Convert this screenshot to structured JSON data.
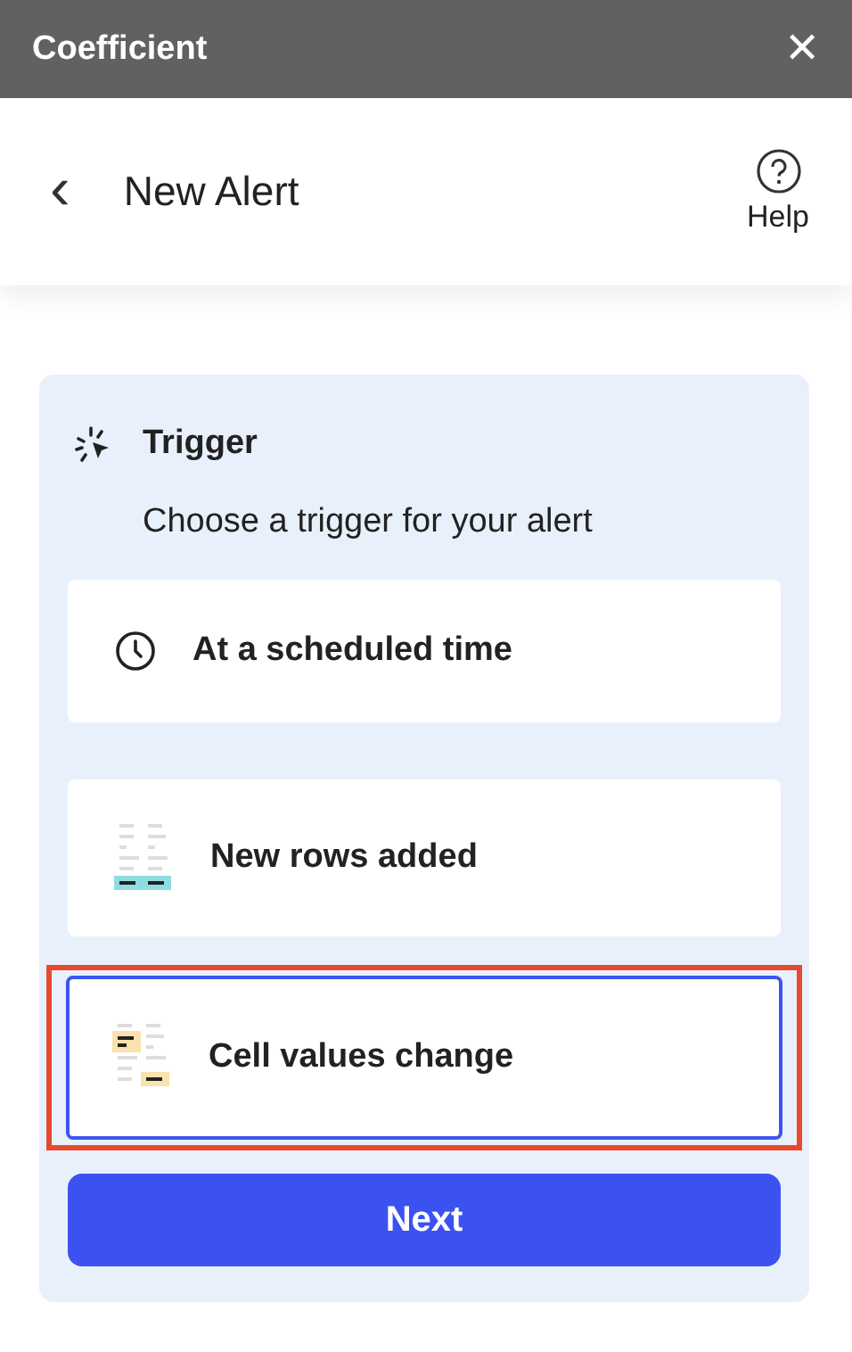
{
  "window": {
    "title": "Coefficient",
    "close": "✕"
  },
  "header": {
    "back": "‹",
    "title": "New Alert",
    "help": "Help"
  },
  "trigger": {
    "title": "Trigger",
    "subtitle": "Choose a trigger for your alert",
    "options": [
      {
        "kind": "clock",
        "label": "At a scheduled time",
        "selected": false,
        "highlighted": false
      },
      {
        "kind": "rows",
        "label": "New rows added",
        "selected": false,
        "highlighted": false
      },
      {
        "kind": "cells",
        "label": "Cell values change",
        "selected": true,
        "highlighted": true
      }
    ],
    "next": "Next"
  }
}
